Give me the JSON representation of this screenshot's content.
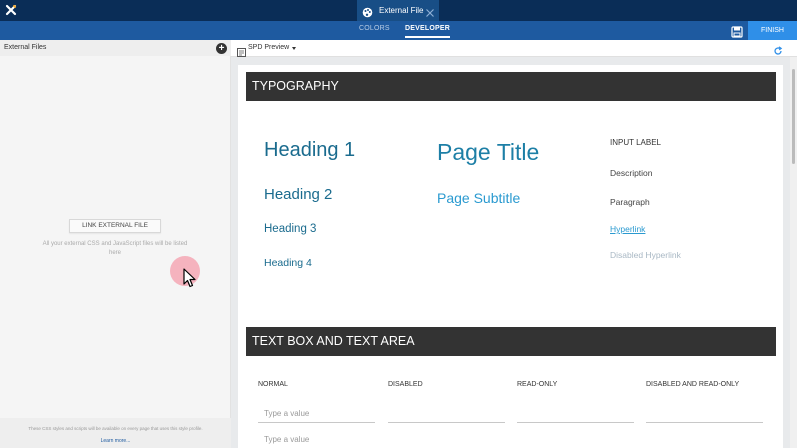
{
  "topbar": {
    "file_tab_label": "External File"
  },
  "subbar": {
    "tabs": [
      {
        "label": "COLORS",
        "active": false
      },
      {
        "label": "DEVELOPER",
        "active": true
      }
    ],
    "finish_label": "FINISH"
  },
  "left_panel": {
    "title": "External Files",
    "link_button_label": "LINK EXTERNAL FILE",
    "empty_message": "All your external CSS and JavaScript files will be listed here",
    "footer_note": "These CSS styles and scripts will be available on every page that uses this style profile.",
    "learn_more": "Learn more..."
  },
  "preview": {
    "mode_label": "SPD Preview",
    "typography": {
      "section_title": "TYPOGRAPHY",
      "heading1": "Heading 1",
      "heading2": "Heading 2",
      "heading3": "Heading 3",
      "heading4": "Heading 4",
      "page_title": "Page Title",
      "page_subtitle": "Page Subtitle",
      "input_label": "INPUT LABEL",
      "description": "Description",
      "paragraph": "Paragraph",
      "hyperlink": "Hyperlink",
      "disabled_hyperlink": "Disabled Hyperlink"
    },
    "textbox": {
      "section_title": "TEXT BOX AND TEXT AREA",
      "columns": [
        "NORMAL",
        "DISABLED",
        "READ-ONLY",
        "DISABLED AND READ-ONLY"
      ],
      "placeholder": "Type a value"
    }
  },
  "colors": {
    "topbar": "#0a2d57",
    "subbar": "#1e5aa0",
    "finish": "#2f8fe8",
    "section_bar": "#333333",
    "heading": "#1a6b8e",
    "link": "#2a9ad0"
  }
}
